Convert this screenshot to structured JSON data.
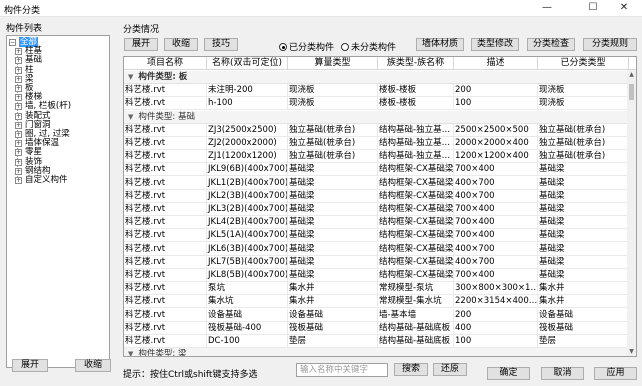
{
  "window": {
    "title": "构件分类",
    "min": "—",
    "max": "☐",
    "close": "✕"
  },
  "left": {
    "title": "构件列表",
    "tree": [
      {
        "exp": "−",
        "label": "全部",
        "root": true
      },
      {
        "exp": "+",
        "label": "柱基"
      },
      {
        "exp": "+",
        "label": "基础"
      },
      {
        "exp": "+",
        "label": "柱"
      },
      {
        "exp": "+",
        "label": "梁"
      },
      {
        "exp": "+",
        "label": "板"
      },
      {
        "exp": "+",
        "label": "楼梯"
      },
      {
        "exp": "+",
        "label": "墙, 栏板(杆)"
      },
      {
        "exp": "+",
        "label": "装配式"
      },
      {
        "exp": "+",
        "label": "门窗洞"
      },
      {
        "exp": "+",
        "label": "圈, 过, 过梁"
      },
      {
        "exp": "+",
        "label": "墙体保温"
      },
      {
        "exp": "+",
        "label": "零星"
      },
      {
        "exp": "+",
        "label": "装饰"
      },
      {
        "exp": "+",
        "label": "钢结构"
      },
      {
        "exp": "+",
        "label": "自定义构件"
      }
    ],
    "expand_btn": "展开",
    "collapse_btn": "收缩"
  },
  "right": {
    "title": "分类情况",
    "toolbar": {
      "expand": "展开",
      "collapse": "收缩",
      "tips": "技巧"
    },
    "radio_classified": "已分类构件",
    "radio_unclassified": "未分类构件",
    "btn_wall_material": "墙体材质",
    "btn_type_modify": "类型修改",
    "btn_classify_check": "分类检查",
    "btn_classify_rule": "分类规则"
  },
  "table": {
    "columns": [
      "项目名称",
      "名称(双击可定位)",
      "算量类型",
      "族类型-族名称",
      "描述",
      "已分类类型"
    ],
    "groups": [
      {
        "label": "构件类型: 板",
        "bold": true,
        "rows": [
          [
            "科艺楼.rvt",
            "未注明-200",
            "现浇板",
            "楼板-楼板",
            "200",
            "现浇板"
          ],
          [
            "科艺楼.rvt",
            "h-100",
            "现浇板",
            "楼板-楼板",
            "100",
            "现浇板"
          ]
        ]
      },
      {
        "label": "构件类型: 基础",
        "bold": false,
        "rows": [
          [
            "科艺楼.rvt",
            "ZJ3(2500x2500)",
            "独立基础(桩承台)",
            "结构基础-独立基…",
            "2500×2500×500",
            "独立基础(桩承台)"
          ],
          [
            "科艺楼.rvt",
            "ZJ2(2000x2000)",
            "独立基础(桩承台)",
            "结构基础-独立基…",
            "2000×2000×400",
            "独立基础(桩承台)"
          ],
          [
            "科艺楼.rvt",
            "ZJ1(1200x1200)",
            "独立基础(桩承台)",
            "结构基础-独立基…",
            "1200×1200×400",
            "独立基础(桩承台)"
          ],
          [
            "科艺楼.rvt",
            "JKL9(6B)(400x700)",
            "基础梁",
            "结构框架-CX基础梁",
            "700×400",
            "基础梁"
          ],
          [
            "科艺楼.rvt",
            "JKL1(2B)(400x700)",
            "基础梁",
            "结构框架-CX基础梁",
            "400×700",
            "基础梁"
          ],
          [
            "科艺楼.rvt",
            "JKL2(3B)(400x700)",
            "基础梁",
            "结构框架-CX基础梁",
            "400×700",
            "基础梁"
          ],
          [
            "科艺楼.rvt",
            "JKL3(2B)(400x700)",
            "基础梁",
            "结构框架-CX基础梁",
            "700×400",
            "基础梁"
          ],
          [
            "科艺楼.rvt",
            "JKL4(2B)(400x700)",
            "基础梁",
            "结构框架-CX基础梁",
            "700×400",
            "基础梁"
          ],
          [
            "科艺楼.rvt",
            "JKL5(1A)(400x700)",
            "基础梁",
            "结构框架-CX基础梁",
            "700×400",
            "基础梁"
          ],
          [
            "科艺楼.rvt",
            "JKL6(3B)(400x700)",
            "基础梁",
            "结构框架-CX基础梁",
            "400×700",
            "基础梁"
          ],
          [
            "科艺楼.rvt",
            "JKL7(5B)(400x700)",
            "基础梁",
            "结构框架-CX基础梁",
            "400×700",
            "基础梁"
          ],
          [
            "科艺楼.rvt",
            "JKL8(5B)(400x700)",
            "基础梁",
            "结构框架-CX基础梁",
            "700×400",
            "基础梁"
          ],
          [
            "科艺楼.rvt",
            "泵坑",
            "集水井",
            "常规模型-泵坑",
            "300×800×300×1…",
            "集水井"
          ],
          [
            "科艺楼.rvt",
            "集水坑",
            "集水井",
            "常规模型-集水坑",
            "2200×3154×400…",
            "集水井"
          ],
          [
            "科艺楼.rvt",
            "设备基础",
            "设备基础",
            "墙-基本墙",
            "200",
            "设备基础"
          ],
          [
            "科艺楼.rvt",
            "筏板基础-400",
            "筏板基础",
            "结构基础-基础底板",
            "400",
            "筏板基础"
          ],
          [
            "科艺楼.rvt",
            "DC-100",
            "垫层",
            "结构基础-基础底板",
            "100",
            "垫层"
          ]
        ]
      },
      {
        "label": "构件类型: 梁",
        "bold": false,
        "rows": []
      }
    ]
  },
  "footer": {
    "hint": "提示：按住Ctrl或shift键支持多选",
    "search_placeholder": "输入名称中关键字",
    "search_btn": "搜索",
    "restore_btn": "还原",
    "ok_btn": "确定",
    "cancel_btn": "取消",
    "apply_btn": "应用"
  }
}
